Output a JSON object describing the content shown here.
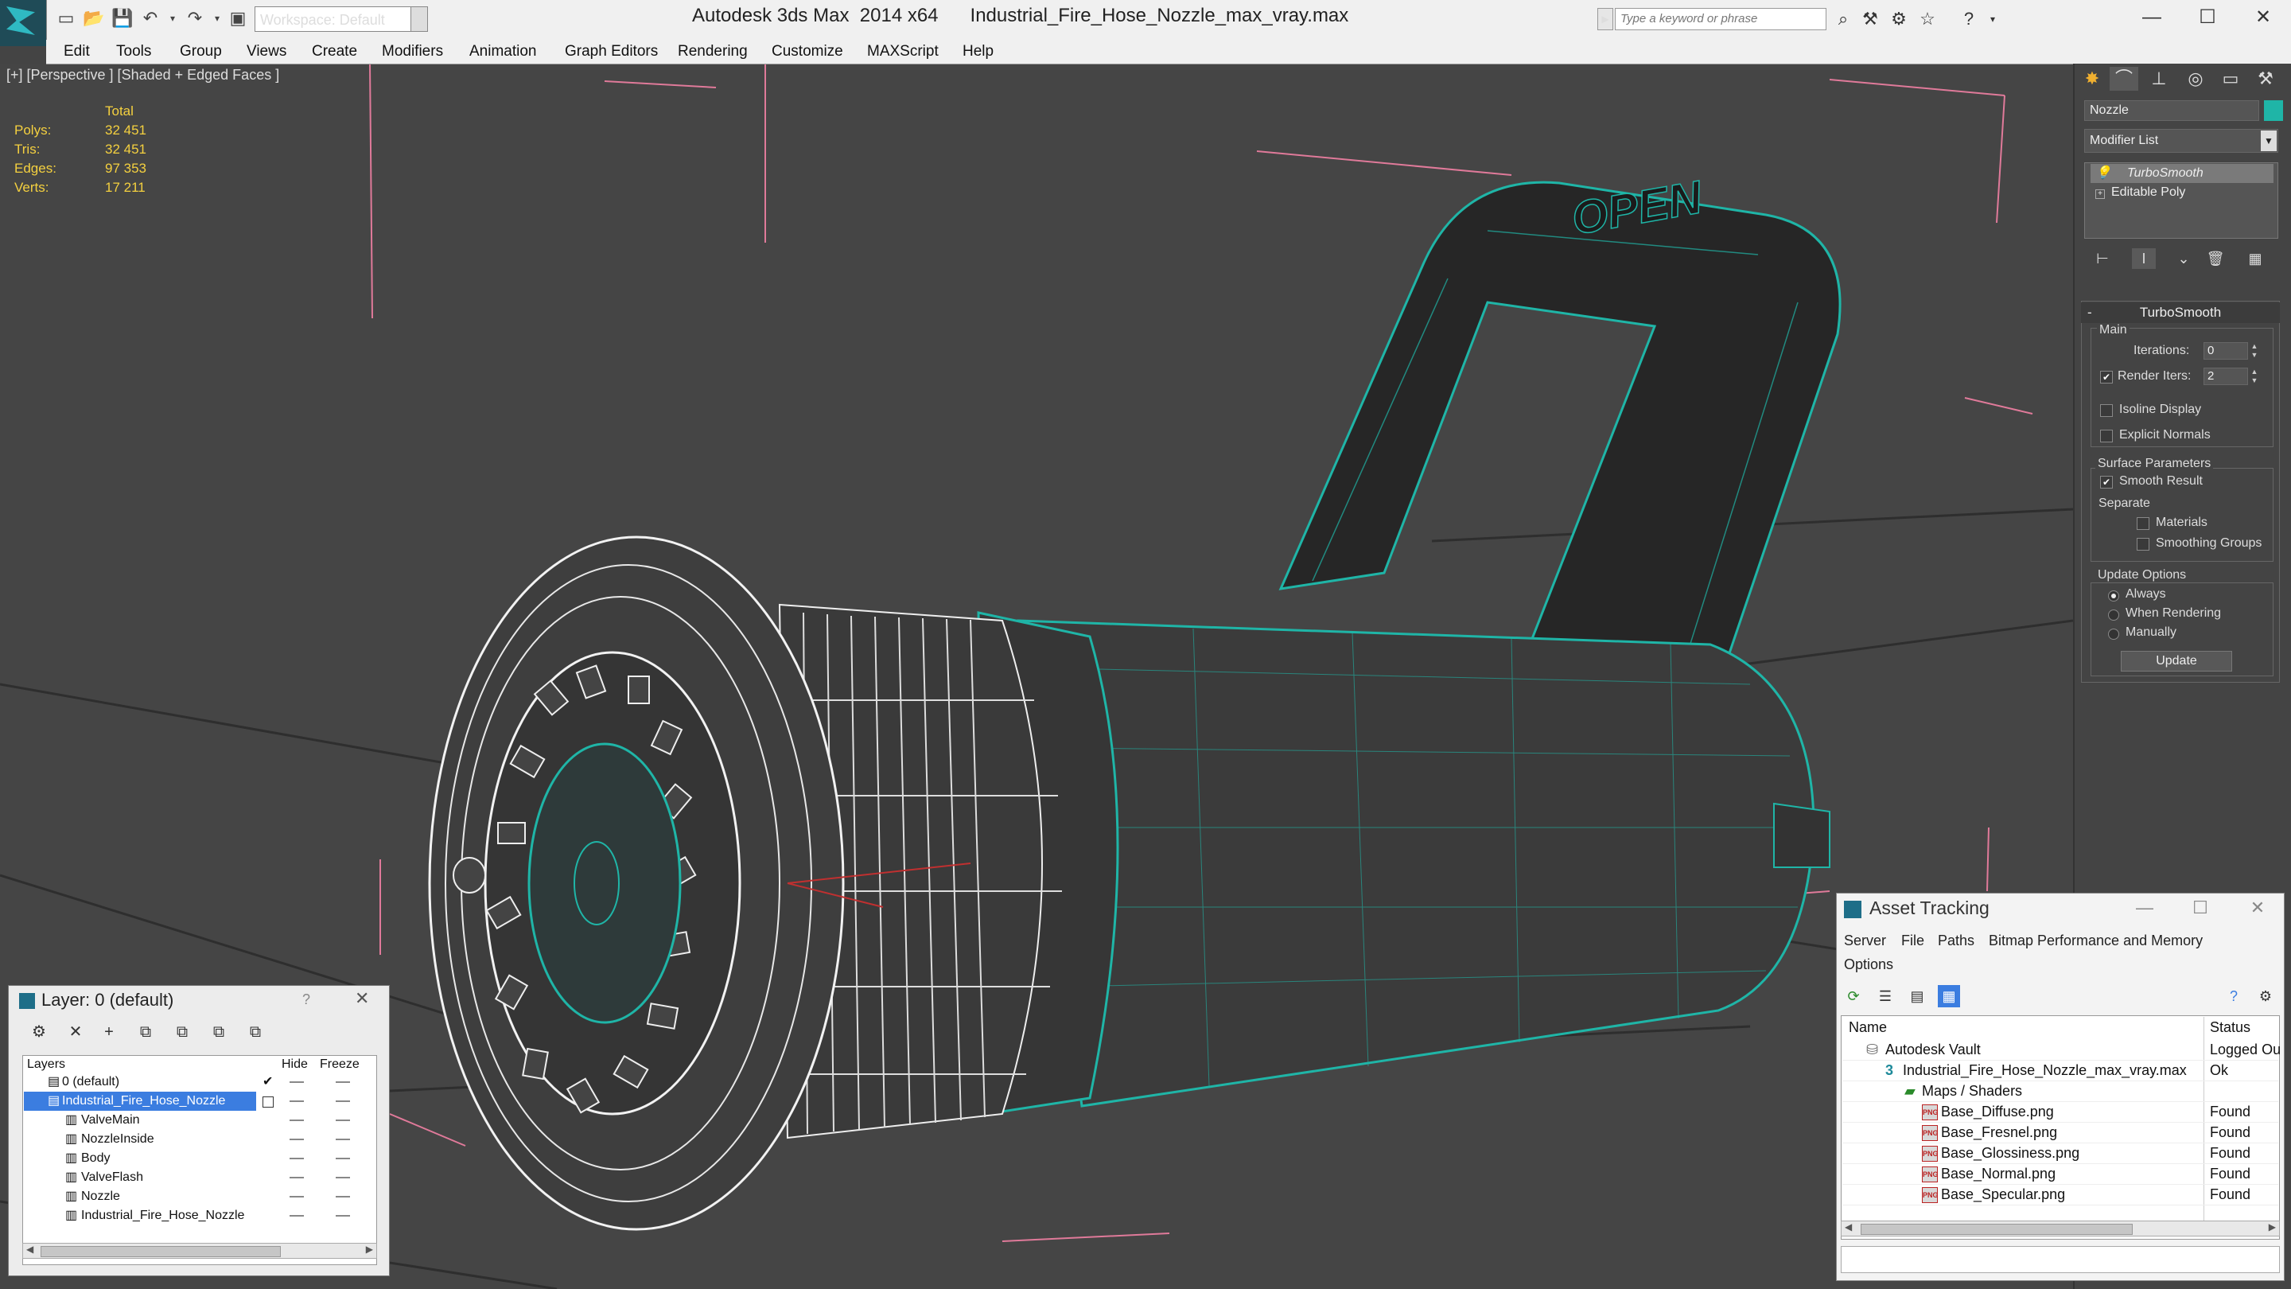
{
  "app": {
    "title_app": "Autodesk 3ds Max  2014 x64",
    "title_file": "Industrial_Fire_Hose_Nozzle_max_vray.max",
    "workspace": "Workspace: Default",
    "search_placeholder": "Type a keyword or phrase",
    "accent_color": "#1fb5a7"
  },
  "menu": [
    "Edit",
    "Tools",
    "Group",
    "Views",
    "Create",
    "Modifiers",
    "Animation",
    "Graph Editors",
    "Rendering",
    "Customize",
    "MAXScript",
    "Help"
  ],
  "viewport": {
    "label": "[+] [Perspective ] [Shaded + Edged Faces ]",
    "stats": {
      "header": "Total",
      "rows": [
        {
          "label": "Polys:",
          "value": "32 451"
        },
        {
          "label": "Tris:",
          "value": "32 451"
        },
        {
          "label": "Edges:",
          "value": "97 353"
        },
        {
          "label": "Verts:",
          "value": "17 211"
        }
      ]
    },
    "handle_text": "OPEN",
    "wire_color": "#1fb5a7"
  },
  "command_panel": {
    "object_name": "Nozzle",
    "modifier_list": "Modifier List",
    "stack": [
      "TurboSmooth",
      "Editable Poly"
    ],
    "rollout": {
      "title": "TurboSmooth",
      "main_label": "Main",
      "iterations_label": "Iterations:",
      "iterations_value": "0",
      "render_iters_label": "Render Iters:",
      "render_iters_value": "2",
      "render_iters_checked": true,
      "isoline": "Isoline Display",
      "explicit_normals": "Explicit Normals",
      "surface_params": "Surface Parameters",
      "smooth_result": "Smooth Result",
      "smooth_result_checked": true,
      "separate": "Separate",
      "materials": "Materials",
      "smoothing_groups": "Smoothing Groups",
      "update_options": "Update Options",
      "always": "Always",
      "when_rendering": "When Rendering",
      "manually": "Manually",
      "update_button": "Update"
    }
  },
  "layer_dialog": {
    "title": "Layer: 0 (default)",
    "help": "?",
    "col_layers": "Layers",
    "col_hide": "Hide",
    "col_freeze": "Freeze",
    "rows": [
      "0 (default)",
      "Industrial_Fire_Hose_Nozzle",
      "ValveMain",
      "NozzleInside",
      "Body",
      "ValveFlash",
      "Nozzle",
      "Industrial_Fire_Hose_Nozzle"
    ]
  },
  "asset_tracking": {
    "title": "Asset Tracking",
    "menu": [
      "Server",
      "File",
      "Paths",
      "Bitmap Performance and Memory",
      "Options"
    ],
    "col_name": "Name",
    "col_status": "Status",
    "rows": [
      {
        "name": "Autodesk Vault",
        "status": "Logged Ou",
        "icon": "vault-icon"
      },
      {
        "name": "Industrial_Fire_Hose_Nozzle_max_vray.max",
        "status": "Ok",
        "icon": "max-file-icon"
      },
      {
        "name": "Maps / Shaders",
        "status": "",
        "icon": "maps-icon"
      },
      {
        "name": "Base_Diffuse.png",
        "status": "Found",
        "icon": "png-icon"
      },
      {
        "name": "Base_Fresnel.png",
        "status": "Found",
        "icon": "png-icon"
      },
      {
        "name": "Base_Glossiness.png",
        "status": "Found",
        "icon": "png-icon"
      },
      {
        "name": "Base_Normal.png",
        "status": "Found",
        "icon": "png-icon"
      },
      {
        "name": "Base_Specular.png",
        "status": "Found",
        "icon": "png-icon"
      }
    ]
  }
}
